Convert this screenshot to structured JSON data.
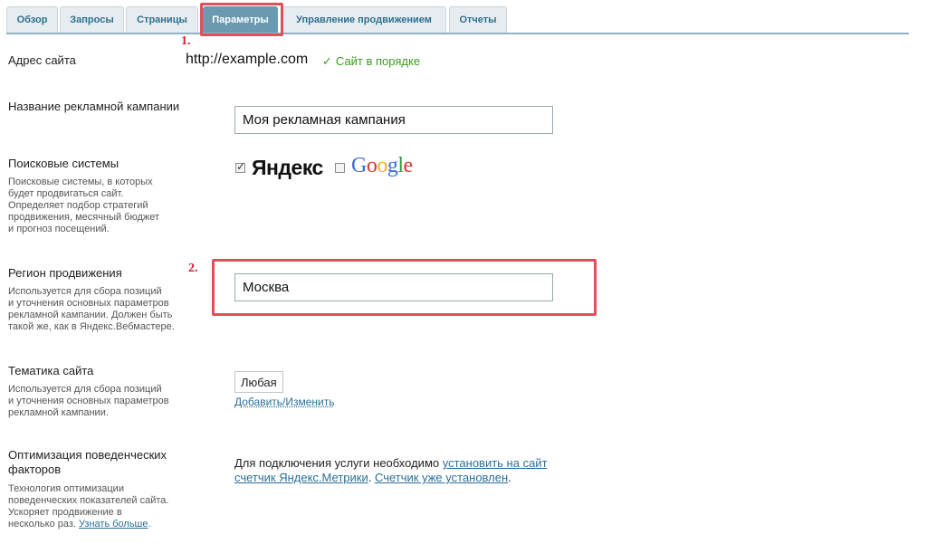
{
  "tabs": [
    {
      "label": "Обзор",
      "active": false
    },
    {
      "label": "Запросы",
      "active": false
    },
    {
      "label": "Страницы",
      "active": false
    },
    {
      "label": "Параметры",
      "active": true
    },
    {
      "label": "Управление продвижением",
      "active": false
    },
    {
      "label": "Отчеты",
      "active": false
    }
  ],
  "annotations": {
    "one": "1.",
    "two": "2."
  },
  "site": {
    "label": "Адрес сайта",
    "url": "http://example.com",
    "status": "Сайт в порядке",
    "status_icon": "check-icon"
  },
  "campaign": {
    "label": "Название рекламной кампании",
    "value": "Моя рекламная кампания"
  },
  "search_engines": {
    "label": "Поисковые системы",
    "desc_lines": [
      "Поисковые системы, в которых",
      "будет продвигаться сайт.",
      "Определяет подбор стратегий",
      "продвижения, месячный бюджет",
      "и прогноз посещений."
    ],
    "yandex_checked": true,
    "google_checked": false,
    "yandex_logo": "Яндекс",
    "google_logo": "Google"
  },
  "region": {
    "label": "Регион продвижения",
    "desc_lines": [
      "Используется для сбора позиций",
      "и уточнения основных параметров",
      "рекламной кампании. Должен быть",
      "такой же, как в Яндекс.Вебмастере."
    ],
    "value": "Москва"
  },
  "theme": {
    "label": "Тематика сайта",
    "desc_lines": [
      "Используется для сбора позиций",
      "и уточнения основных параметров",
      "рекламной кампании."
    ],
    "value": "Любая",
    "edit_link": "Добавить/Изменить"
  },
  "behavior": {
    "label_lines": [
      "Оптимизация поведенческих",
      "факторов"
    ],
    "desc_lines": [
      "Технология оптимизации",
      "поведенческих показателей сайта.",
      "Ускоряет продвижение в"
    ],
    "desc_last": "несколько раз.",
    "learn_more": "Узнать больше",
    "learn_more_suffix": ".",
    "text_before": "Для подключения услуги необходимо",
    "link_install": "установить на сайт счетчик Яндекс.Метрики",
    "text_mid": ".",
    "link_installed": "Счетчик уже установлен",
    "text_end": "."
  },
  "colors": {
    "accent": "#6b9ab0",
    "link": "#2a6f98",
    "ok": "#3a9a1d",
    "annotation": "#e0505a"
  }
}
